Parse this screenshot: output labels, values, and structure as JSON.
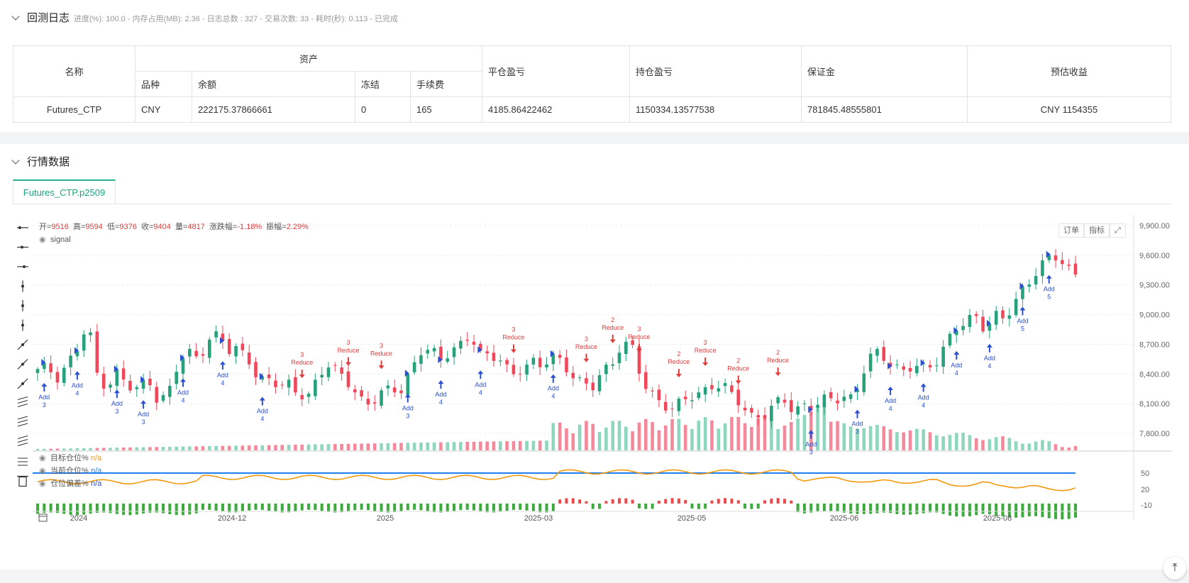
{
  "log": {
    "title": "回测日志",
    "stats": "进度(%): 100.0 - 内存占用(MB): 2.36 - 日志总数 : 327 - 交易次数: 33 - 耗时(秒): 0.113 - 已完成"
  },
  "assets_table": {
    "h_name": "名称",
    "h_assets": "资产",
    "h_variety": "品种",
    "h_balance": "余额",
    "h_frozen": "冻结",
    "h_fee": "手续费",
    "h_close_pnl": "平仓盈亏",
    "h_hold_pnl": "持仓盈亏",
    "h_margin": "保证金",
    "h_est": "预估收益",
    "row": {
      "name": "Futures_CTP",
      "variety": "CNY",
      "balance": "222175.37866661",
      "frozen": "0",
      "fee": "165",
      "close_pnl": "4185.86422462",
      "hold_pnl": "1150334.13577538",
      "margin": "781845.48555801",
      "est": "CNY 1154355"
    }
  },
  "market": {
    "title": "行情数据",
    "tab": "Futures_CTP.p2509",
    "order_btn": "订单",
    "indicator_btn": "指标",
    "ohlc": {
      "open_label": "开=",
      "open": "9516",
      "high_label": "高=",
      "high": "9594",
      "low_label": "低=",
      "low": "9376",
      "close_label": "收=",
      "close": "9404",
      "vol_label": "量=",
      "vol": "4817",
      "chg_label": "涨跌幅=",
      "chg": "-1.18%",
      "amp_label": "振幅=",
      "amp": "2.29%"
    },
    "signal_label": "signal",
    "sub_legend": [
      {
        "label": "目标仓位%",
        "value": "n/a",
        "color": "#f29a0e"
      },
      {
        "label": "当前仓位%",
        "value": "n/a",
        "color": "#1f7ef0"
      },
      {
        "label": "仓位偏差%",
        "value": "n/a",
        "color": "#2a4fd1"
      }
    ]
  },
  "chart_data": {
    "type": "candlestick",
    "price_axis_ticks": [
      "9,900.00",
      "9,600.00",
      "9,300.00",
      "9,000.00",
      "8,700.00",
      "8,400.00",
      "8,100.00",
      "7,800.00"
    ],
    "price_ylim": [
      7700,
      9950
    ],
    "sub_axis_ticks": [
      "50",
      "20",
      "-10"
    ],
    "x_tick_labels": [
      "2024",
      "2024-12",
      "2025",
      "2025-03",
      "2025-05",
      "2025-06",
      "2025-08"
    ],
    "close_path": [
      8420,
      8460,
      8380,
      8520,
      8650,
      8900,
      8350,
      8300,
      8420,
      8250,
      8230,
      8380,
      8120,
      8200,
      8500,
      8620,
      8600,
      8740,
      8780,
      8620,
      8680,
      8560,
      8300,
      8320,
      8280,
      8330,
      8200,
      8150,
      8380,
      8520,
      8440,
      8290,
      8100,
      8080,
      8240,
      8280,
      8200,
      8380,
      8640,
      8700,
      8540,
      8600,
      8680,
      8820,
      8620,
      8560,
      8520,
      8380,
      8480,
      8540,
      8450,
      8560,
      8540,
      8420,
      8300,
      8230,
      8420,
      8520,
      8740,
      8650,
      8300,
      8200,
      8120,
      8050,
      8100,
      8170,
      8240,
      8300,
      8280,
      8150,
      8080,
      7980,
      7980,
      8060,
      8130,
      8050,
      8100,
      8060,
      8120,
      8140,
      8200,
      8160,
      8420,
      8620,
      8580,
      8500,
      8420,
      8460,
      8450,
      8520,
      8700,
      8820,
      8900,
      9000,
      8880,
      9000,
      8920,
      9120,
      9300,
      9440,
      9540,
      9560,
      9500,
      9404
    ],
    "markers": [
      {
        "type": "Add",
        "n": "3",
        "i": 1
      },
      {
        "type": "Add",
        "n": "4",
        "i": 6
      },
      {
        "type": "Add",
        "n": "3",
        "i": 12
      },
      {
        "type": "Add",
        "n": "3",
        "i": 16
      },
      {
        "type": "Add",
        "n": "4",
        "i": 22
      },
      {
        "type": "Add",
        "n": "4",
        "i": 28
      },
      {
        "type": "Add",
        "n": "4",
        "i": 34
      },
      {
        "type": "Reduce",
        "n": "3",
        "i": 40
      },
      {
        "type": "Reduce",
        "n": "3",
        "i": 47
      },
      {
        "type": "Reduce",
        "n": "3",
        "i": 52
      },
      {
        "type": "Add",
        "n": "3",
        "i": 56
      },
      {
        "type": "Add",
        "n": "4",
        "i": 61
      },
      {
        "type": "Add",
        "n": "4",
        "i": 67
      },
      {
        "type": "Reduce",
        "n": "3",
        "i": 72
      },
      {
        "type": "Add",
        "n": "4",
        "i": 78
      },
      {
        "type": "Reduce",
        "n": "3",
        "i": 83
      },
      {
        "type": "Reduce",
        "n": "2",
        "i": 87
      },
      {
        "type": "Reduce",
        "n": "3",
        "i": 91
      },
      {
        "type": "Reduce",
        "n": "2",
        "i": 97
      },
      {
        "type": "Reduce",
        "n": "3",
        "i": 101
      },
      {
        "type": "Reduce",
        "n": "2",
        "i": 106
      },
      {
        "type": "Reduce",
        "n": "2",
        "i": 112
      },
      {
        "type": "Add",
        "n": "3",
        "i": 117
      },
      {
        "type": "Add",
        "n": "3",
        "i": 124
      },
      {
        "type": "Add",
        "n": "4",
        "i": 129
      },
      {
        "type": "Add",
        "n": "4",
        "i": 134
      },
      {
        "type": "Add",
        "n": "4",
        "i": 139
      },
      {
        "type": "Add",
        "n": "4",
        "i": 144
      },
      {
        "type": "Add",
        "n": "5",
        "i": 149
      },
      {
        "type": "Add",
        "n": "5",
        "i": 153
      }
    ],
    "colors": {
      "up": "#26a17b",
      "down": "#f0475a",
      "vol_up": "#8ed6bd",
      "vol_down": "#f3899a",
      "target": "#f29a0e",
      "current": "#1f7ef0",
      "bar_pos": "#e94b4b",
      "bar_neg": "#3caa3c",
      "marker": "#2a4fd1",
      "reduce": "#e23b3b"
    }
  }
}
